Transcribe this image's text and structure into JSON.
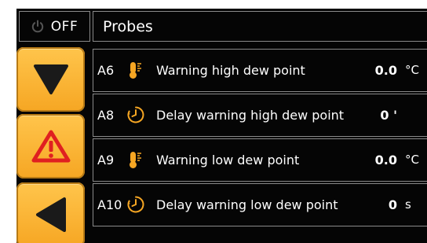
{
  "header": {
    "power_icon": "power-icon",
    "power_label": "OFF",
    "title": "Probes"
  },
  "side_buttons": [
    {
      "icon": "arrow-down-icon"
    },
    {
      "icon": "warning-icon"
    },
    {
      "icon": "arrow-left-icon"
    }
  ],
  "rows": [
    {
      "code": "A6",
      "icon": "thermometer-icon",
      "label": "Warning high dew point",
      "value": "0.0",
      "unit": "°C"
    },
    {
      "code": "A8",
      "icon": "timer-icon",
      "label": "Delay warning high dew point",
      "value": "0 '",
      "unit": ""
    },
    {
      "code": "A9",
      "icon": "thermometer-icon",
      "label": "Warning low dew point",
      "value": "0.0",
      "unit": "°C"
    },
    {
      "code": "A10",
      "icon": "timer-icon",
      "label": "Delay warning low dew point",
      "value": "0",
      "unit": "s"
    }
  ],
  "colors": {
    "accent": "#f6a623",
    "background": "#050505",
    "border": "#8a8a8a",
    "icon_warning_red": "#e02020"
  }
}
